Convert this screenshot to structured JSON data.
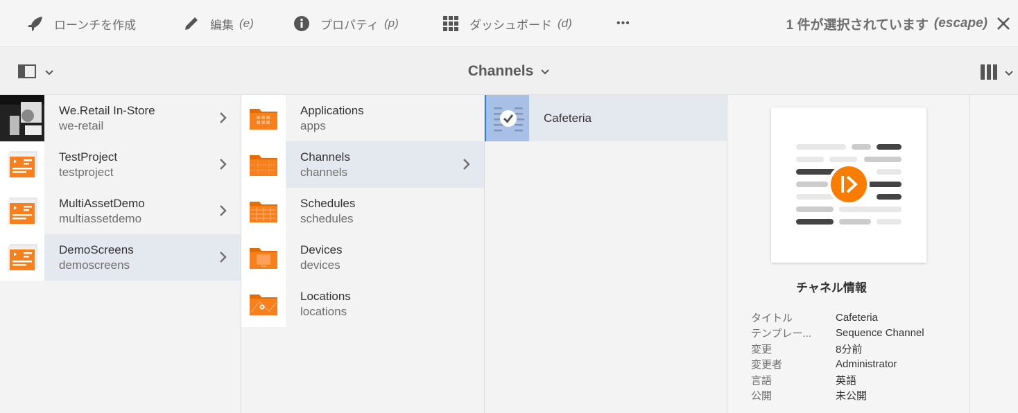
{
  "actionbar": {
    "create_launch": "ローンチを作成",
    "edit": "編集",
    "edit_hint": "(e)",
    "properties": "プロパティ",
    "properties_hint": "(p)",
    "dashboard": "ダッシュボード",
    "dashboard_hint": "(d)",
    "more": "•••",
    "selection": "1 件が選択されています",
    "selection_hint": "(escape)"
  },
  "titlebar": {
    "title": "Channels"
  },
  "columns": {
    "projects": [
      {
        "title": "We.Retail In-Store",
        "subtitle": "we-retail"
      },
      {
        "title": "TestProject",
        "subtitle": "testproject"
      },
      {
        "title": "MultiAssetDemo",
        "subtitle": "multiassetdemo"
      },
      {
        "title": "DemoScreens",
        "subtitle": "demoscreens"
      }
    ],
    "folders": [
      {
        "title": "Applications",
        "subtitle": "apps"
      },
      {
        "title": "Channels",
        "subtitle": "channels"
      },
      {
        "title": "Schedules",
        "subtitle": "schedules"
      },
      {
        "title": "Devices",
        "subtitle": "devices"
      },
      {
        "title": "Locations",
        "subtitle": "locations"
      }
    ],
    "channels": [
      {
        "title": "Cafeteria"
      }
    ]
  },
  "details": {
    "heading": "チャネル情報",
    "meta": [
      {
        "key": "タイトル",
        "value": "Cafeteria"
      },
      {
        "key": "テンプレー...",
        "value": "Sequence Channel"
      },
      {
        "key": "変更",
        "value": "8分前"
      },
      {
        "key": "変更者",
        "value": "Administrator"
      },
      {
        "key": "言語",
        "value": "英語"
      },
      {
        "key": "公開",
        "value": "未公開"
      }
    ]
  },
  "colors": {
    "accent_orange": "#fa7d00",
    "selection_blue": "#2680eb"
  }
}
